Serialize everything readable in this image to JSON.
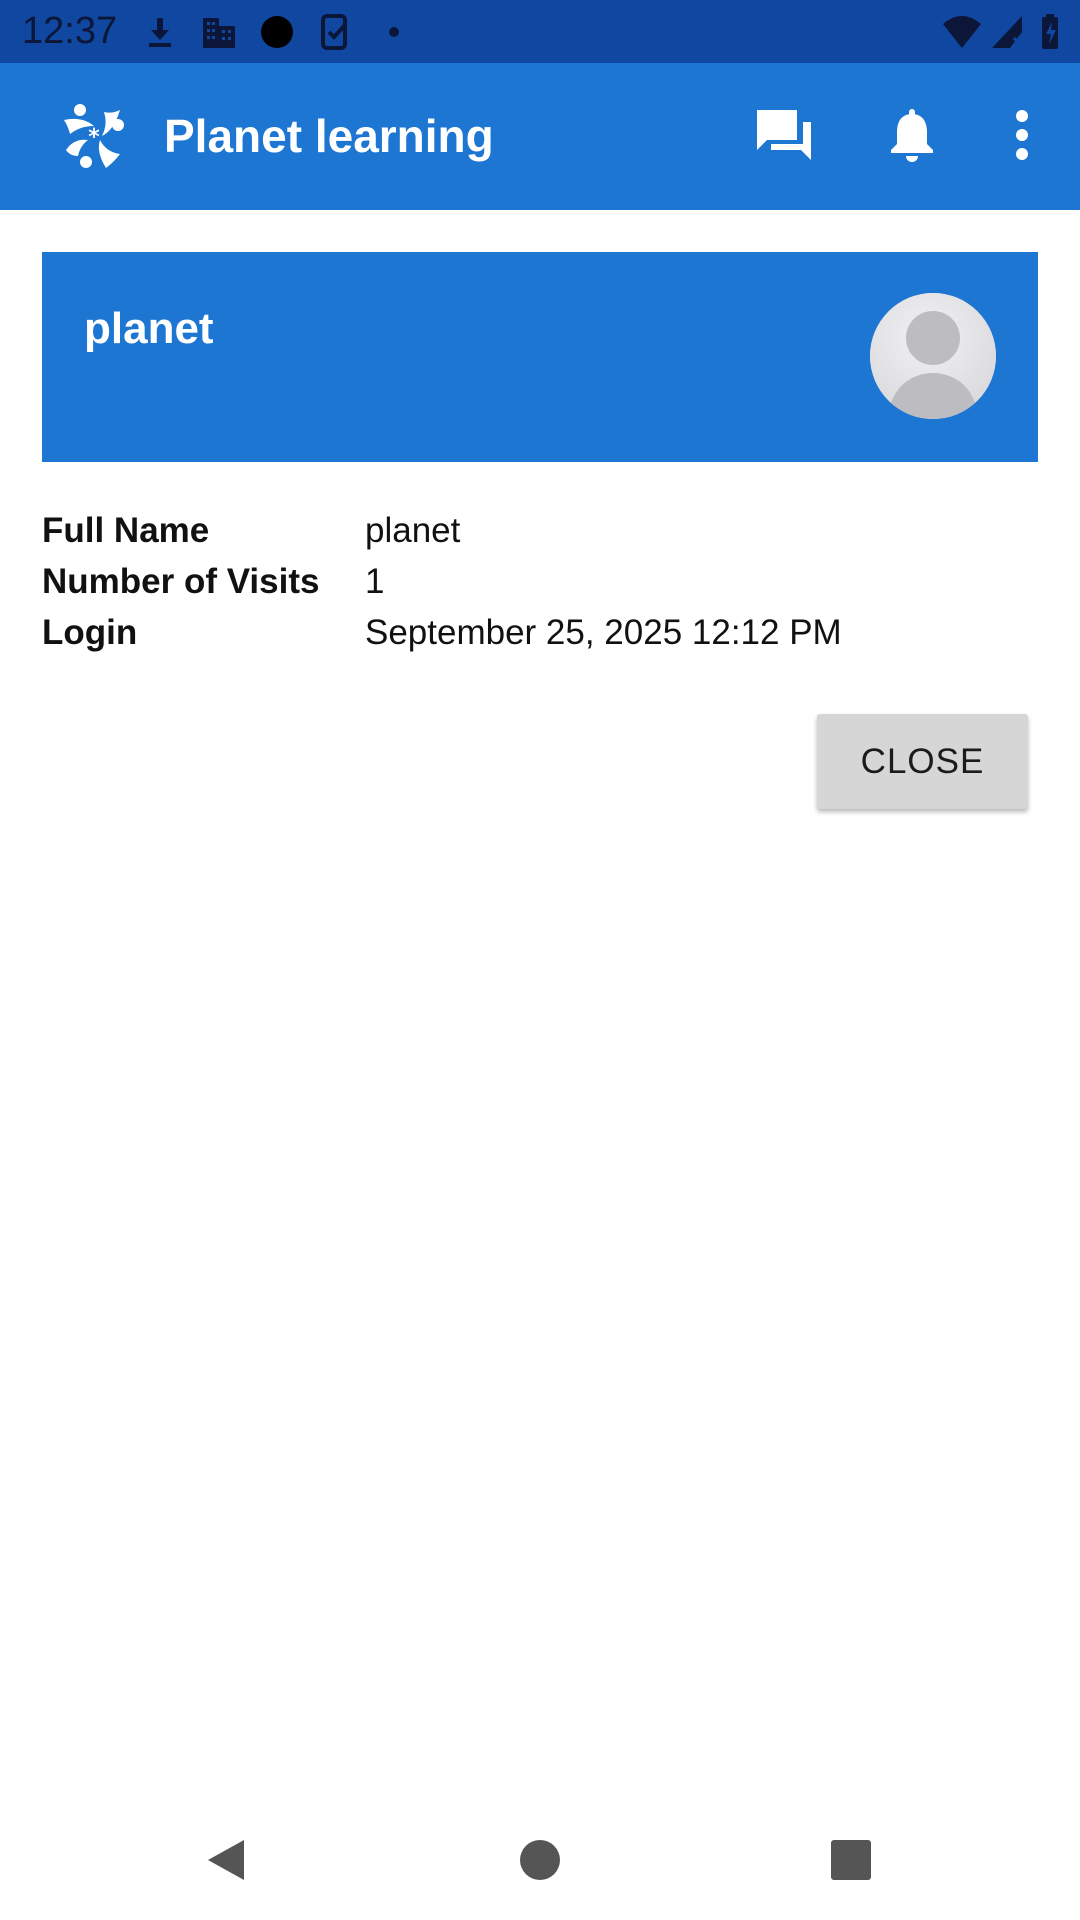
{
  "status_bar": {
    "time": "12:37",
    "icons": [
      "download-icon",
      "building-icon",
      "circle-icon",
      "phone-check-icon",
      "dot-icon",
      "wifi-icon",
      "signal-icon",
      "battery-icon"
    ]
  },
  "app_bar": {
    "title": "Planet learning",
    "logo_icon": "planet-logo-icon",
    "actions": [
      "chat-icon",
      "bell-icon",
      "more-vert-icon"
    ]
  },
  "profile": {
    "name": "planet",
    "avatar_icon": "avatar-icon"
  },
  "details": [
    {
      "label": "Full Name",
      "value": "planet"
    },
    {
      "label": "Number of Visits",
      "value": "1"
    },
    {
      "label": "Login",
      "value": "September 25, 2025 12:12 PM"
    }
  ],
  "close_label": "CLOSE",
  "nav_bar": {
    "buttons": [
      "back-icon",
      "home-icon",
      "recents-icon"
    ]
  },
  "colors": {
    "status_bar": "#0f47a1",
    "app_bar": "#1c76d2",
    "card": "#1c76d2",
    "button_bg": "#d6d6d6"
  }
}
